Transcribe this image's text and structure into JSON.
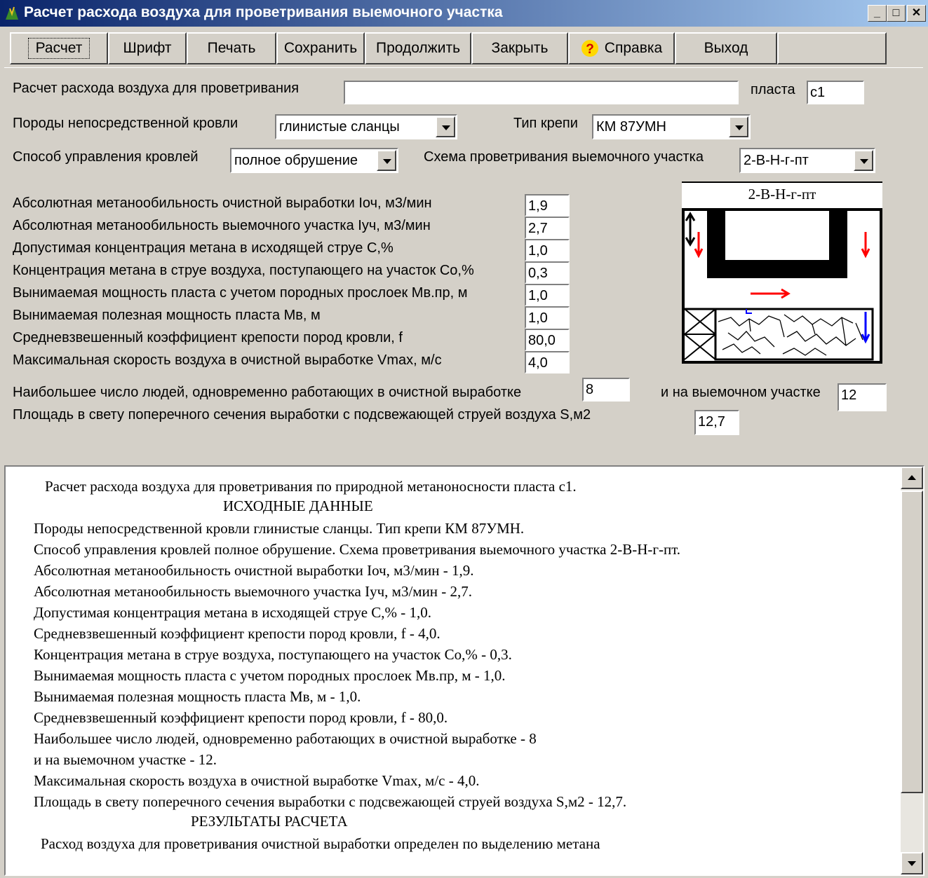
{
  "window": {
    "title": "Расчет расхода воздуха для проветривания выемочного участка"
  },
  "caption_buttons": {
    "minimize": "_",
    "maximize": "□",
    "close": "✕"
  },
  "toolbar": {
    "calc": "Расчет",
    "font": "Шрифт",
    "print": "Печать",
    "save": "Сохранить",
    "continue": "Продолжить",
    "close": "Закрыть",
    "help": "Справка",
    "exit": "Выход"
  },
  "form": {
    "title_label": "Расчет расхода воздуха для проветривания",
    "title_value": "",
    "seam_label": "пласта",
    "seam_value": "с1",
    "roof_label": "Породы непосредственной кровли",
    "roof_value": "глинистые сланцы",
    "support_label": "Тип крепи",
    "support_value": "КМ 87УМН",
    "control_label": "Способ управления кровлей",
    "control_value": "полное обрушение",
    "scheme_label": "Схема проветривания выемочного участка",
    "scheme_value": "2-В-Н-г-пт",
    "params": [
      {
        "label": "Абсолютная метанообильность очистной выработки Iоч, м3/мин",
        "value": "1,9"
      },
      {
        "label": "Абсолютная метанообильность выемочного участка Iуч, м3/мин",
        "value": "2,7"
      },
      {
        "label": "Допустимая концентрация метана в исходящей струе С,%",
        "value": "1,0"
      },
      {
        "label": "Концентрация метана в струе воздуха, поступающего на участок Со,%",
        "value": "0,3"
      },
      {
        "label": "Вынимаемая мощность пласта с учетом породных прослоек Мв.пр, м",
        "value": "1,0"
      },
      {
        "label": "Вынимаемая полезная мощность пласта Мв, м",
        "value": "1,0"
      },
      {
        "label": "Средневзвешенный коэффициент крепости пород кровли, f",
        "value": "80,0"
      },
      {
        "label": "Максимальная скорость воздуха в очистной выработке Vmax, м/с",
        "value": "4,0"
      }
    ],
    "people_label": "Наибольшее число людей, одновременно работающих в очистной выработке",
    "people_value": "8",
    "people_area_label": "и на выемочном участке",
    "people_area_value": "12",
    "section_label": "Площадь в свету поперечного сечения выработки с подсвежающей струей воздуха S,м2",
    "section_value": "12,7"
  },
  "diagram": {
    "caption": "2-В-Н-г-пт"
  },
  "report": [
    "Расчет расхода воздуха для проветривания  по природной метаноносности пласта с1.",
    "ИСХОДНЫЕ ДАННЫЕ",
    "Породы непосредственной кровли глинистые сланцы. Тип крепи КМ 87УМН.",
    "Способ управления кровлей полное обрушение. Схема проветривания выемочного участка 2-В-Н-г-пт.",
    "Абсолютная метанообильность очистной выработки Iоч, м3/мин - 1,9.",
    "Абсолютная метанообильность выемочного участка Iуч, м3/мин - 2,7.",
    "Допустимая концентрация метана в исходящей струе С,% - 1,0.",
    "Средневзвешенный коэффициент крепости пород кровли, f - 4,0.",
    "Концентрация метана в струе воздуха, поступающего на участок Со,% - 0,3.",
    "Вынимаемая мощность пласта с учетом породных прослоек Мв.пр, м - 1,0.",
    "Вынимаемая полезная мощность пласта Мв, м - 1,0.",
    "Средневзвешенный коэффициент крепости пород кровли, f - 80,0.",
    "Наибольшее число людей, одновременно работающих в очистной выработке - 8",
    "и на выемочном участке - 12.",
    "Максимальная скорость воздуха в очистной выработке Vmax, м/с - 4,0.",
    "Площадь в свету поперечного сечения выработки с подсвежающей струей воздуха S,м2 - 12,7.",
    "РЕЗУЛЬТАТЫ РАСЧЕТА",
    "Расход воздуха для проветривания очистной выработки определен по выделению метана"
  ],
  "colors": {
    "face": "#d4d0c8",
    "title_start": "#0a246a",
    "title_end": "#a6caf0",
    "arrow_red": "#ff0000",
    "arrow_blue": "#0000ff"
  }
}
